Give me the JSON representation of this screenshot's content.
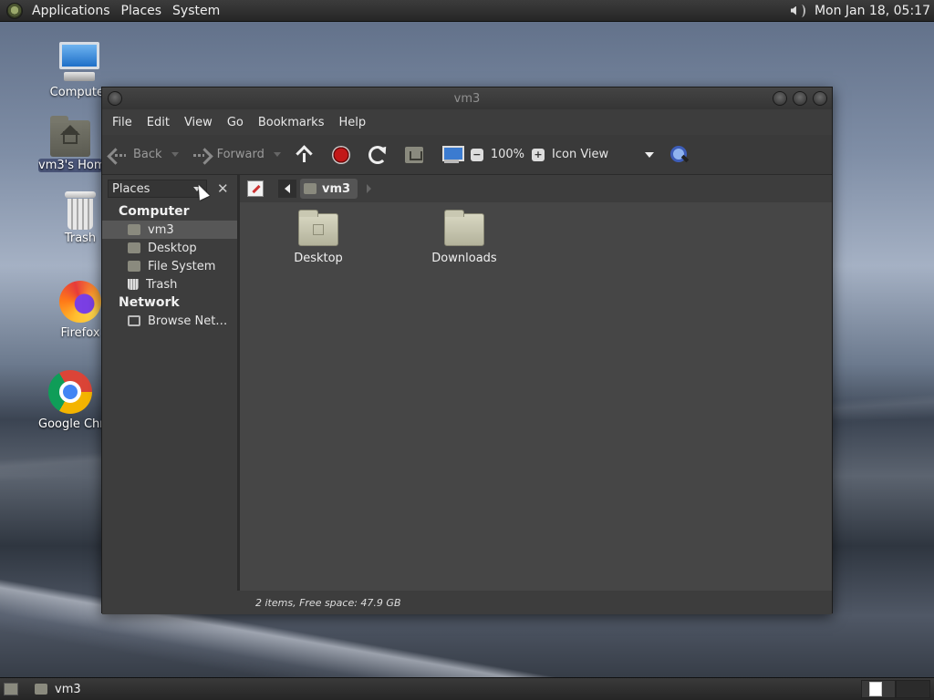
{
  "top_panel": {
    "menus": [
      "Applications",
      "Places",
      "System"
    ],
    "clock": "Mon Jan 18, 05:17"
  },
  "desktop_icons": [
    {
      "label": "Computer",
      "icon": "computer-icon"
    },
    {
      "label": "vm3's Home",
      "icon": "home-folder-icon"
    },
    {
      "label": "Trash",
      "icon": "trash-icon"
    },
    {
      "label": "Firefox",
      "icon": "firefox-icon"
    },
    {
      "label": "Google Chrome",
      "icon": "chrome-icon"
    }
  ],
  "window": {
    "title": "vm3",
    "menu": [
      "File",
      "Edit",
      "View",
      "Go",
      "Bookmarks",
      "Help"
    ],
    "toolbar": {
      "back": "Back",
      "forward": "Forward",
      "zoom": "100%",
      "view_mode": "Icon View"
    },
    "sidebar": {
      "selector": "Places",
      "sections": [
        {
          "title": "Computer",
          "items": [
            {
              "label": "vm3",
              "icon": "home-icon",
              "selected": true
            },
            {
              "label": "Desktop",
              "icon": "desktop-folder-icon"
            },
            {
              "label": "File System",
              "icon": "drive-icon"
            },
            {
              "label": "Trash",
              "icon": "trash-icon"
            }
          ]
        },
        {
          "title": "Network",
          "items": [
            {
              "label": "Browse Net…",
              "icon": "network-icon"
            }
          ]
        }
      ]
    },
    "pathbar": {
      "current": "vm3"
    },
    "files": [
      {
        "label": "Desktop",
        "icon": "desktop-folder-icon"
      },
      {
        "label": "Downloads",
        "icon": "folder-icon"
      }
    ],
    "status": "2 items, Free space: 47.9 GB"
  },
  "bottom_panel": {
    "task": "vm3"
  },
  "colors": {
    "panel": "#262626",
    "window_bg": "#3f3f3f",
    "content_bg": "#464646",
    "selection": "#575757"
  }
}
